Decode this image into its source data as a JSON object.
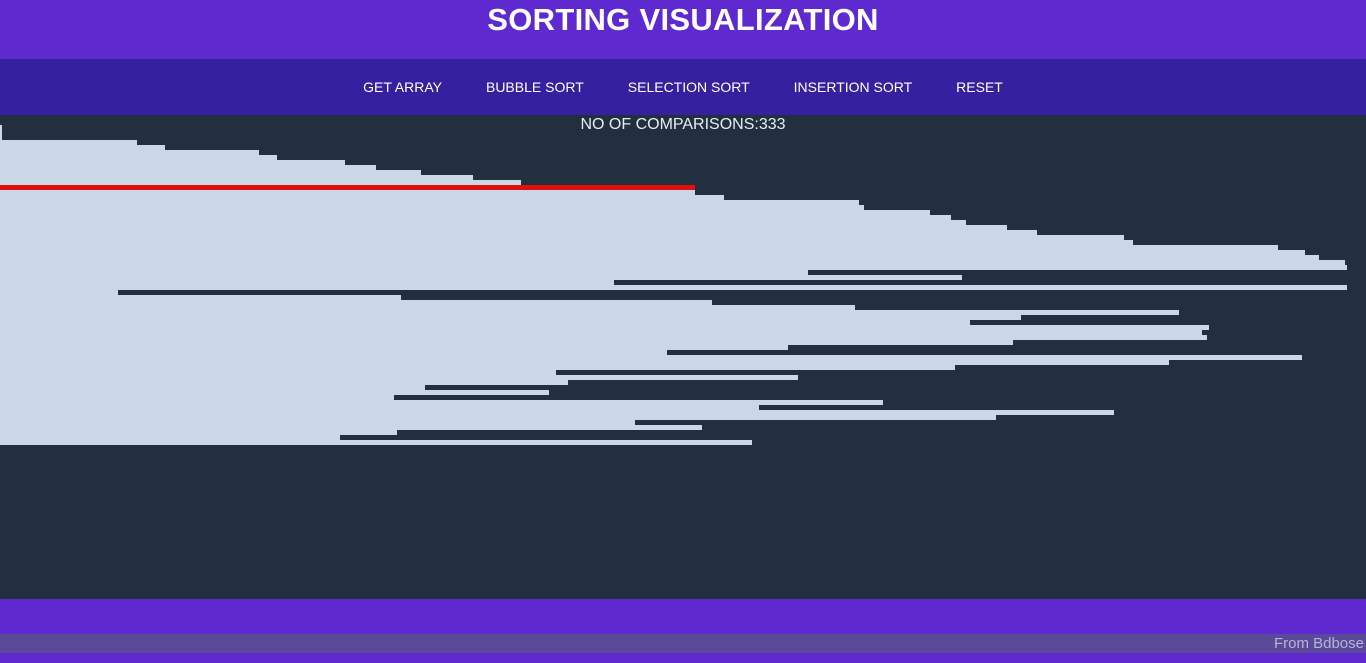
{
  "header": {
    "title": "SORTING VISUALIZATION"
  },
  "nav": {
    "items": [
      {
        "label": "GET ARRAY"
      },
      {
        "label": "BUBBLE SORT"
      },
      {
        "label": "SELECTION SORT"
      },
      {
        "label": "INSERTION SORT"
      },
      {
        "label": "RESET"
      }
    ]
  },
  "visualization": {
    "comparisons_text": "NO OF COMPARISONS:333",
    "bar_color": "#c9d7e6",
    "active_bar_color": "#e01010",
    "background_color": "#222f3f",
    "active_index": 14,
    "max_value": 1366,
    "values": [
      0,
      0,
      2,
      2,
      2,
      137,
      165,
      259,
      277,
      345,
      376,
      421,
      473,
      521,
      695,
      695,
      724,
      859,
      864,
      930,
      951,
      966,
      1007,
      1037,
      1124,
      1133,
      1278,
      1305,
      1319,
      1345,
      1347,
      808,
      962,
      614,
      1347,
      118,
      401,
      712,
      855,
      1179,
      1021,
      970,
      1209,
      1202,
      1207,
      1013,
      788,
      667,
      1302,
      1169,
      955,
      556,
      798,
      568,
      425,
      549,
      394,
      883,
      759,
      1114,
      996,
      635,
      702,
      397,
      340,
      752
    ]
  },
  "footer": {
    "text": "From Bdbose"
  }
}
